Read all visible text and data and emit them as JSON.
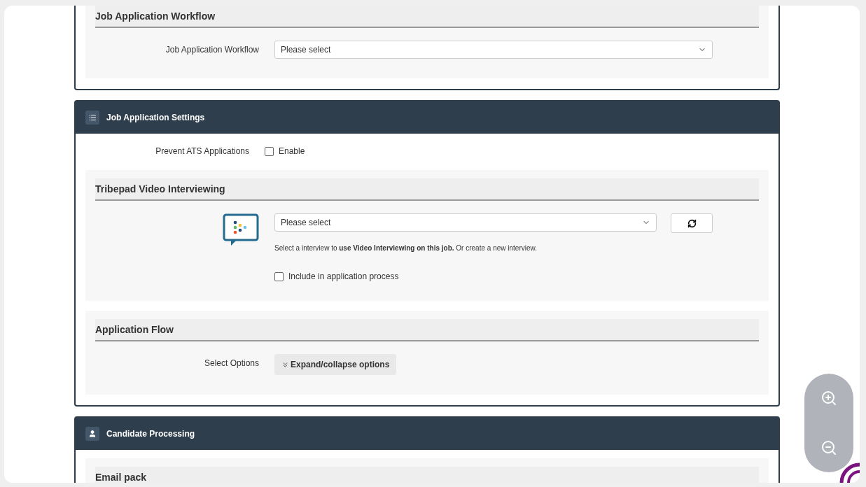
{
  "sections": [
    {
      "subsections": [
        {
          "title": "Job Application Workflow",
          "rows": [
            {
              "kind": "select",
              "label": "Job Application Workflow",
              "placeholder": "Please select"
            }
          ]
        }
      ]
    },
    {
      "header": {
        "title": "Job Application Settings"
      },
      "rows": [
        {
          "kind": "checkbox",
          "label": "Prevent ATS Applications",
          "option": "Enable",
          "checked": false
        }
      ],
      "subsections": [
        {
          "title": "Tribepad Video Interviewing",
          "rows": [
            {
              "kind": "video",
              "placeholder": "Please select",
              "help": "Select a interview to **use Video Interviewing on this job.** Or create a new interview.",
              "option": "Include in application process",
              "checked": false
            }
          ]
        },
        {
          "title": "Application Flow",
          "rows": [
            {
              "kind": "expand",
              "label": "Select Options",
              "button": "Expand/collapse options"
            }
          ]
        }
      ]
    },
    {
      "header": {
        "title": "Candidate Processing"
      },
      "subsections": [
        {
          "title": "Email pack"
        }
      ]
    }
  ]
}
